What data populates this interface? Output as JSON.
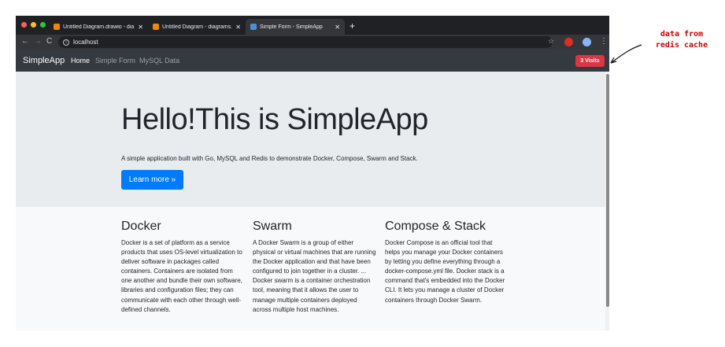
{
  "browser": {
    "tabs": [
      {
        "title": "Untitled Diagram.drawio - dia",
        "active": false,
        "favicon_color": "#f08705"
      },
      {
        "title": "Untitled Diagram - diagrams.n",
        "active": false,
        "favicon_color": "#f08705"
      },
      {
        "title": "Simple Form - SimpleApp",
        "active": true,
        "favicon_color": "#4a90d9"
      }
    ],
    "new_tab_icon": "plus-icon",
    "nav_icons": [
      "back-icon",
      "forward-icon",
      "reload-icon"
    ],
    "url": "localhost"
  },
  "navbar": {
    "brand": "SimpleApp",
    "links": [
      {
        "label": "Home",
        "active": true
      },
      {
        "label": "Simple Form",
        "active": false
      },
      {
        "label": "MySQL Data",
        "active": false
      }
    ],
    "visits_badge": "3 Visits"
  },
  "jumbotron": {
    "title": "Hello!This is SimpleApp",
    "lead": "A simple application built with Go, MySQL and Redis to demonstrate Docker, Compose, Swarm and Stack.",
    "button": "Learn more »"
  },
  "columns": [
    {
      "heading": "Docker",
      "text": "Docker is a set of platform as a service products that uses OS-level virtualization to deliver software in packages called containers. Containers are isolated from one another and bundle their own software, libraries and configuration files; they can communicate with each other through well-defined channels."
    },
    {
      "heading": "Swarm",
      "text": "A Docker Swarm is a group of either physical or virtual machines that are running the Docker application and that have been configured to join together in a cluster. ... Docker swarm is a container orchestration tool, meaning that it allows the user to manage multiple containers deployed across multiple host machines."
    },
    {
      "heading": "Compose & Stack",
      "text": "Docker Compose is an official tool that helps you manage your Docker containers by letting you define everything through a docker-compose.yml file. Docker stack is a command that's embedded into the Docker CLI. It lets you manage a cluster of Docker containers through Docker Swarm."
    }
  ],
  "annotation": {
    "line1": "data from",
    "line2": "redis cache"
  },
  "colors": {
    "navbar_bg": "#343a40",
    "badge_red": "#dc3545",
    "primary_blue": "#007bff",
    "annotation_red": "#cc0000"
  }
}
